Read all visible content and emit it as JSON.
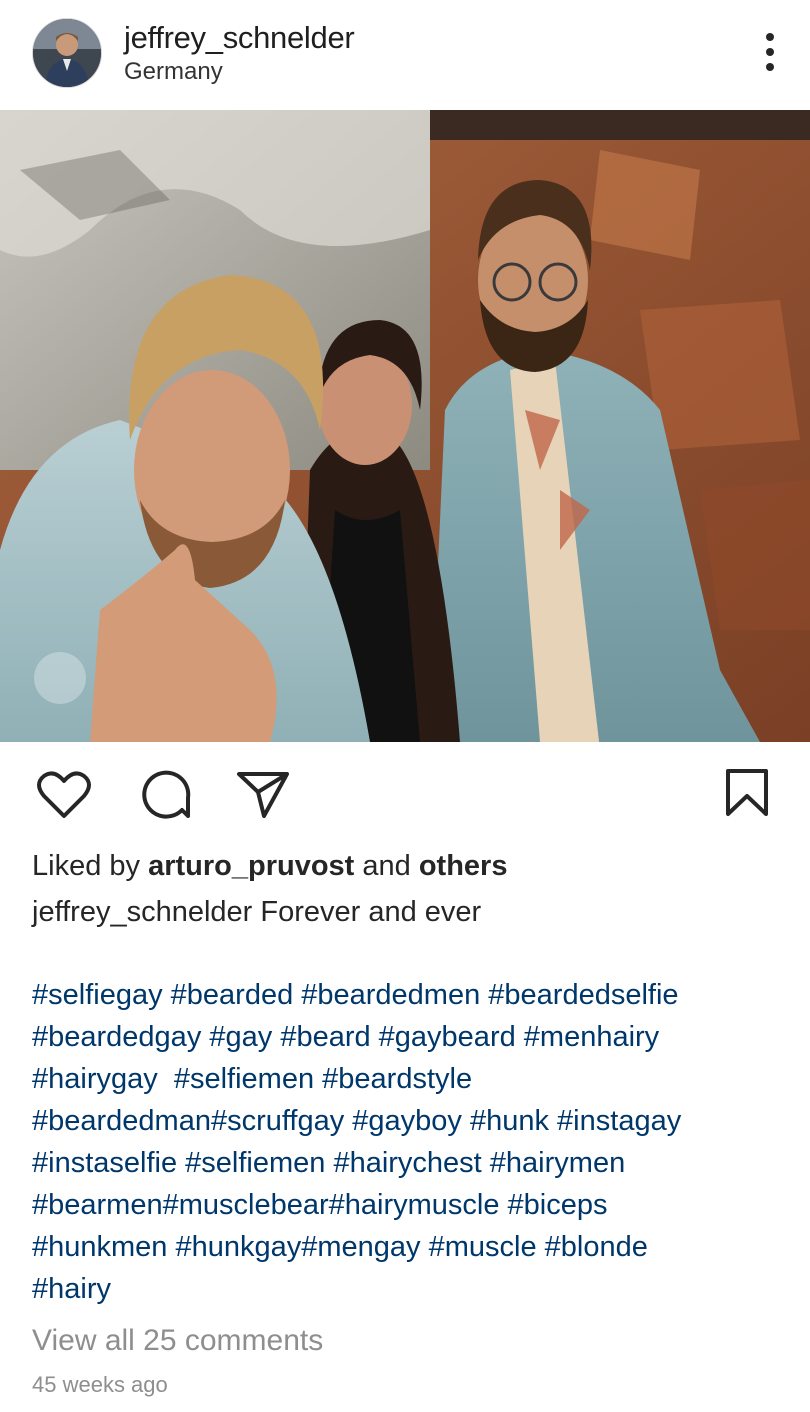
{
  "post": {
    "username": "jeffrey_schnelder",
    "location": "Germany",
    "likes": {
      "prefix": "Liked by ",
      "user": "arturo_pruvost",
      "middle": " and ",
      "others": "others"
    },
    "caption": {
      "user": "jeffrey_schnelder",
      "text": " Forever and ever"
    },
    "hashtag_lines": [
      "#selfiegay #bearded #beardedmen #beardedselfie",
      "#beardedgay #gay #beard #gaybeard #menhairy",
      "#hairygay  #selfiemen #beardstyle",
      "#beardedman#scruffgay #gayboy #hunk #instagay",
      "#instaselfie #selfiemen #hairychest #hairymen",
      "#bearmen#musclebear#hairymuscle #biceps",
      "#hunkmen #hunkgay#mengay #muscle #blonde",
      "#hairy"
    ],
    "view_comments": "View all 25 comments",
    "timestamp": "45 weeks ago"
  },
  "icons": {
    "more": "more-vertical-icon",
    "like": "heart-icon",
    "comment": "comment-icon",
    "share": "send-icon",
    "save": "bookmark-icon"
  },
  "colors": {
    "hashtag": "#00376b",
    "muted": "#8e8e8e",
    "text": "#262626"
  }
}
